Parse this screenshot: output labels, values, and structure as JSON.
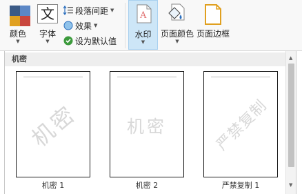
{
  "ribbon": {
    "colors": {
      "label": "颜色",
      "icon": "theme-colors-icon"
    },
    "fonts": {
      "label": "字体",
      "glyph": "文",
      "icon": "theme-fonts-icon"
    },
    "paragraph_spacing": {
      "label": "段落间距",
      "icon": "paragraph-spacing-icon"
    },
    "effects": {
      "label": "效果",
      "icon": "effects-icon"
    },
    "set_default": {
      "label": "设为默认值",
      "icon": "check-circle-icon"
    },
    "watermark": {
      "label": "水印",
      "icon": "watermark-icon"
    },
    "page_color": {
      "label": "页面颜色",
      "icon": "paint-bucket-icon"
    },
    "page_borders": {
      "label": "页面边框",
      "icon": "page-borders-icon"
    }
  },
  "gallery": {
    "category": "机密",
    "tiles": [
      {
        "caption": "机密 1",
        "watermark_text": "机密",
        "orientation": "diagonal"
      },
      {
        "caption": "机密 2",
        "watermark_text": "机密",
        "orientation": "horizontal"
      },
      {
        "caption": "严禁复制 1",
        "watermark_text": "严禁复制",
        "orientation": "diagonal"
      }
    ]
  },
  "colors": {
    "selected_bg": "#cde6f7",
    "ribbon_bg": "#f8f8f8",
    "watermark_gray": "#d8d8d8"
  }
}
